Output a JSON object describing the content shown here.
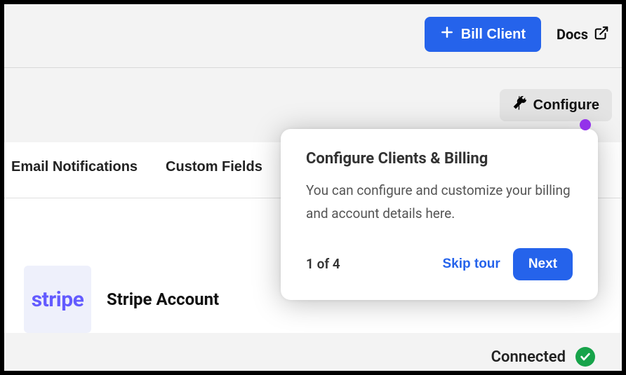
{
  "header": {
    "bill_client_label": "Bill Client",
    "docs_label": "Docs"
  },
  "configure": {
    "button_label": "Configure"
  },
  "tabs": [
    {
      "label": "Email Notifications"
    },
    {
      "label": "Custom Fields"
    }
  ],
  "stripe": {
    "logo_text": "stripe",
    "title": "Stripe Account",
    "status": "Connected"
  },
  "popover": {
    "title": "Configure Clients & Billing",
    "body": "You can configure and customize your billing and account details here.",
    "step": "1 of 4",
    "skip_label": "Skip tour",
    "next_label": "Next"
  }
}
